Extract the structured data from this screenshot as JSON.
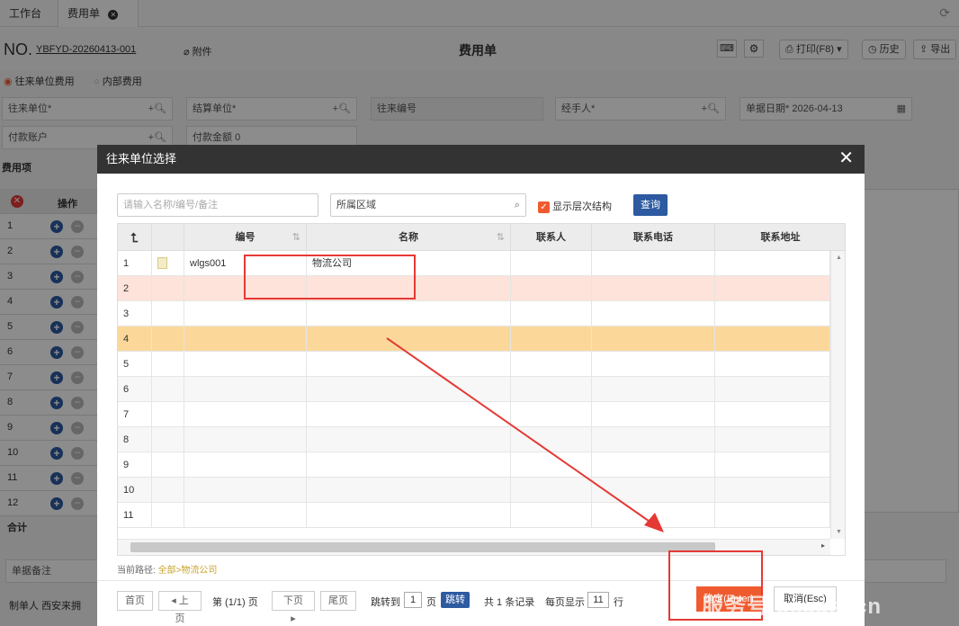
{
  "tabs": [
    {
      "label": "工作台"
    },
    {
      "label": "费用单"
    }
  ],
  "header": {
    "no_label": "NO.",
    "no_value": "YBFYD-20260413-001",
    "attach": "附件",
    "title": "费用单",
    "print": "打印(F8)",
    "history": "历史",
    "export": "导出"
  },
  "radios": {
    "external": "往来单位费用",
    "internal": "内部费用"
  },
  "fields": {
    "partner": "往来单位*",
    "settle": "结算单位*",
    "partner_no": "往来编号",
    "handler": "经手人*",
    "date_label": "单据日期*",
    "date_value": "2026-04-13",
    "pay_account": "付款账户",
    "pay_amount_label": "付款金额",
    "pay_amount_value": "0"
  },
  "section": {
    "items": "费用项",
    "ops": "操作",
    "total": "合计",
    "remark": "单据备注",
    "maker": "制单人",
    "maker_value": "西安来拥"
  },
  "left_rows": [
    "1",
    "2",
    "3",
    "4",
    "5",
    "6",
    "7",
    "8",
    "9",
    "10",
    "11",
    "12"
  ],
  "dialog": {
    "title": "往来单位选择",
    "search_placeholder": "请输入名称/编号/备注",
    "region": "所属区域",
    "show_tree": "显示层次结构",
    "query": "查询",
    "columns": [
      "编号",
      "名称",
      "联系人",
      "联系电话",
      "联系地址"
    ],
    "rows": [
      {
        "n": "1",
        "code": "wlgs001",
        "name": "物流公司"
      },
      {
        "n": "2",
        "code": "",
        "name": ""
      },
      {
        "n": "3",
        "code": "",
        "name": ""
      },
      {
        "n": "4",
        "code": "",
        "name": ""
      },
      {
        "n": "5",
        "code": "",
        "name": ""
      },
      {
        "n": "6",
        "code": "",
        "name": ""
      },
      {
        "n": "7",
        "code": "",
        "name": ""
      },
      {
        "n": "8",
        "code": "",
        "name": ""
      },
      {
        "n": "9",
        "code": "",
        "name": ""
      },
      {
        "n": "10",
        "code": "",
        "name": ""
      },
      {
        "n": "11",
        "code": "",
        "name": ""
      }
    ],
    "path_label": "当前路径:",
    "path_all": "全部",
    "path_sep": ">",
    "path_cur": "物流公司",
    "first": "首页",
    "prev": "◂ 上页",
    "page_info": "第 (1/1) 页",
    "next": "下页 ▸",
    "last": "尾页",
    "jump_label": "跳转到",
    "jump_value": "1",
    "page_unit": "页",
    "jump_btn": "跳转",
    "total": "共 1 条记录",
    "per_page_label": "每页显示",
    "per_page_value": "11",
    "per_page_unit": "行",
    "confirm": "确定(Enter)",
    "cancel": "取消(Esc)"
  },
  "watermark": "服务号 bsaas_cn",
  "colors": {
    "accent": "#2d5aa0",
    "highlight": "#fbd89a",
    "selected": "#fde3da",
    "confirm": "#ef5b2f",
    "annotation": "#e53935"
  }
}
